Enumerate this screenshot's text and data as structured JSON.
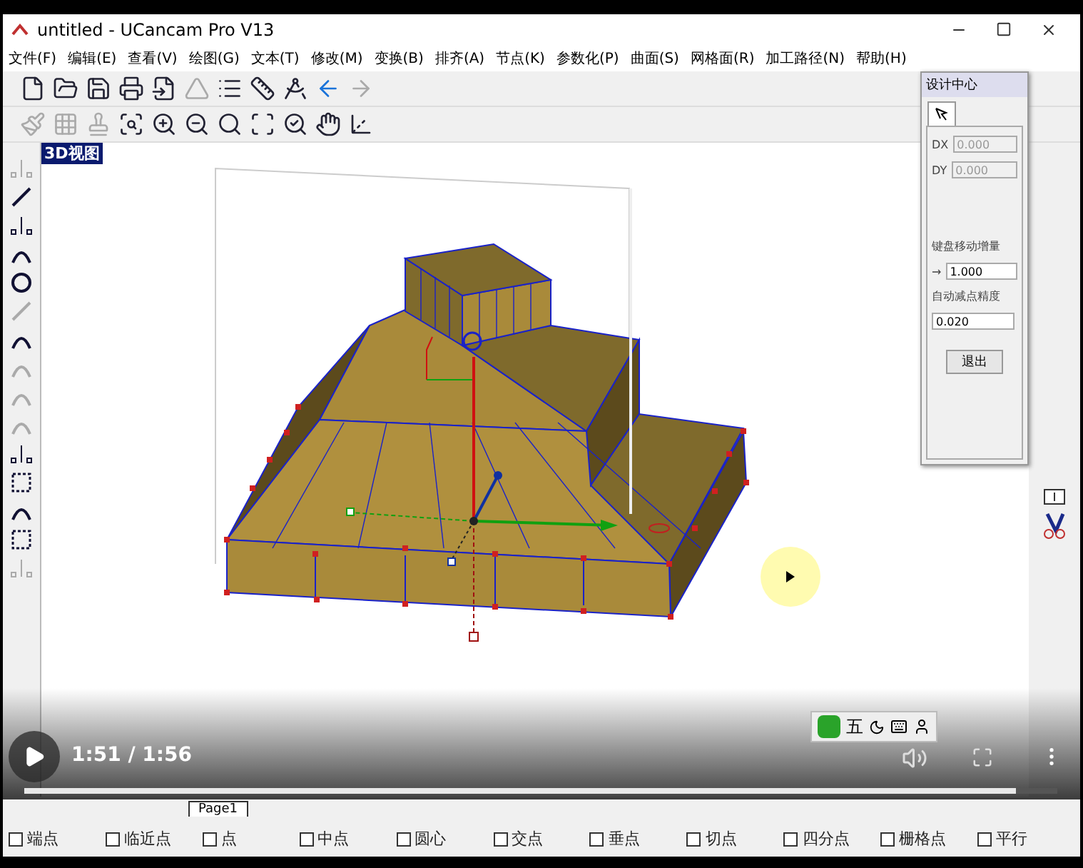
{
  "window": {
    "title": "untitled - UCancam Pro V13"
  },
  "menu": [
    "文件(F)",
    "编辑(E)",
    "查看(V)",
    "绘图(G)",
    "文本(T)",
    "修改(M)",
    "变换(B)",
    "排齐(A)",
    "节点(K)",
    "参数化(P)",
    "曲面(S)",
    "网格面(R)",
    "加工路径(N)",
    "帮助(H)"
  ],
  "toolbars": [
    [
      {
        "kind": "new",
        "disabled": false
      },
      {
        "kind": "open",
        "disabled": false
      },
      {
        "kind": "save",
        "disabled": false
      },
      {
        "kind": "print",
        "disabled": false
      },
      {
        "kind": "import",
        "disabled": false
      },
      {
        "kind": "shape",
        "disabled": true
      },
      {
        "kind": "list",
        "disabled": false
      },
      {
        "kind": "ruler",
        "disabled": false
      },
      {
        "kind": "angle",
        "disabled": false
      },
      {
        "kind": "back",
        "disabled": false
      },
      {
        "kind": "forward",
        "disabled": true
      }
    ],
    [
      {
        "kind": "brush",
        "disabled": true
      },
      {
        "kind": "grid",
        "disabled": true
      },
      {
        "kind": "stamp",
        "disabled": true
      },
      {
        "kind": "zoom-window",
        "disabled": false
      },
      {
        "kind": "zoom-in",
        "disabled": false
      },
      {
        "kind": "zoom-out",
        "disabled": false
      },
      {
        "kind": "zoom-all",
        "disabled": false
      },
      {
        "kind": "fit",
        "disabled": false
      },
      {
        "kind": "zoom-page",
        "disabled": false
      },
      {
        "kind": "pan",
        "disabled": false
      },
      {
        "kind": "axes",
        "disabled": false
      }
    ]
  ],
  "left_tools": [
    {
      "kind": "node",
      "disabled": true
    },
    {
      "kind": "line",
      "disabled": false
    },
    {
      "kind": "node",
      "disabled": false
    },
    {
      "kind": "curve",
      "disabled": false
    },
    {
      "kind": "circle",
      "disabled": false
    },
    {
      "kind": "line",
      "disabled": true
    },
    {
      "kind": "curve",
      "disabled": false
    },
    {
      "kind": "curve",
      "disabled": true
    },
    {
      "kind": "curve",
      "disabled": true
    },
    {
      "kind": "curve",
      "disabled": true
    },
    {
      "kind": "node",
      "disabled": false
    },
    {
      "kind": "box",
      "disabled": false
    },
    {
      "kind": "curve",
      "disabled": false
    },
    {
      "kind": "box",
      "disabled": false
    },
    {
      "kind": "node",
      "disabled": true
    }
  ],
  "view_label": "3D视图",
  "panel": {
    "title": "设计中心",
    "fields": [
      {
        "label": "DX",
        "value": "0.000",
        "disabled": true
      },
      {
        "label": "DY",
        "value": "0.000",
        "disabled": true
      }
    ],
    "step_label": "键盘移动增量",
    "step_arrow": "→",
    "step_value": "1.000",
    "precision_label": "自动减点精度",
    "precision_value": "0.020",
    "exit_button": "退出"
  },
  "page_tab": "Page1",
  "snaps": [
    {
      "label": "端点",
      "checked": false
    },
    {
      "label": "临近点",
      "checked": false
    },
    {
      "label": "点",
      "checked": false
    },
    {
      "label": "中点",
      "checked": false
    },
    {
      "label": "圆心",
      "checked": false
    },
    {
      "label": "交点",
      "checked": false
    },
    {
      "label": "垂点",
      "checked": false
    },
    {
      "label": "切点",
      "checked": false
    },
    {
      "label": "四分点",
      "checked": false
    },
    {
      "label": "栅格点",
      "checked": false
    },
    {
      "label": "平行",
      "checked": false
    }
  ],
  "ime": {
    "label": "五"
  },
  "player": {
    "time": "1:51 / 1:56",
    "level": 0.96
  }
}
